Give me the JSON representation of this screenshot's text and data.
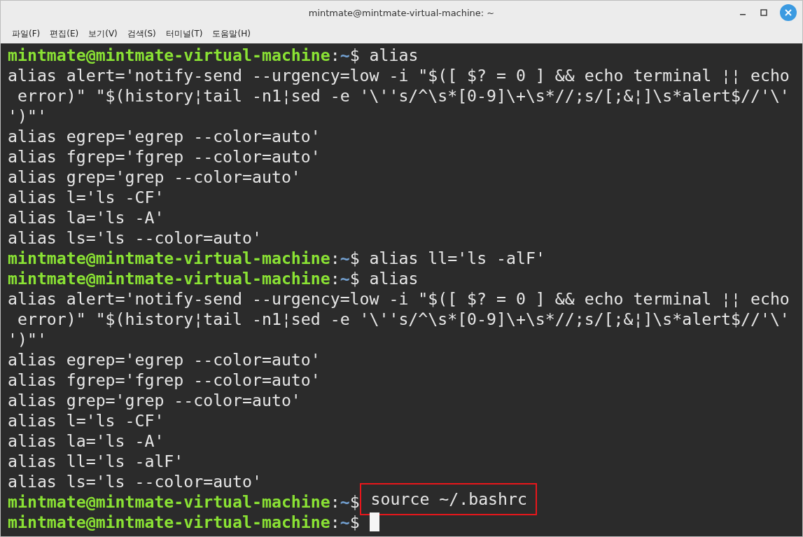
{
  "window": {
    "title": "mintmate@mintmate-virtual-machine: ~"
  },
  "menu": [
    "파일(F)",
    "편집(E)",
    "보기(V)",
    "검색(S)",
    "터미널(T)",
    "도움말(H)"
  ],
  "terminal": {
    "lines": [
      {
        "kind": "prompt",
        "user_host": "mintmate@mintmate-virtual-machine",
        "separator": ":",
        "path": "~",
        "symbol": "$",
        "command": "alias"
      },
      {
        "kind": "output",
        "text": "alias alert='notify-send --urgency=low -i \"$([ $? = 0 ] && echo terminal ¦¦ echo"
      },
      {
        "kind": "output",
        "text": " error)\" \"$(history¦tail -n1¦sed -e '\\''s/^\\s*[0-9]\\+\\s*//;s/[;&¦]\\s*alert$//'\\'"
      },
      {
        "kind": "output",
        "text": "')\"'"
      },
      {
        "kind": "output",
        "text": "alias egrep='egrep --color=auto'"
      },
      {
        "kind": "output",
        "text": "alias fgrep='fgrep --color=auto'"
      },
      {
        "kind": "output",
        "text": "alias grep='grep --color=auto'"
      },
      {
        "kind": "output",
        "text": "alias l='ls -CF'"
      },
      {
        "kind": "output",
        "text": "alias la='ls -A'"
      },
      {
        "kind": "output",
        "text": "alias ls='ls --color=auto'"
      },
      {
        "kind": "prompt",
        "user_host": "mintmate@mintmate-virtual-machine",
        "separator": ":",
        "path": "~",
        "symbol": "$",
        "command": "alias ll='ls -alF'"
      },
      {
        "kind": "prompt",
        "user_host": "mintmate@mintmate-virtual-machine",
        "separator": ":",
        "path": "~",
        "symbol": "$",
        "command": "alias"
      },
      {
        "kind": "output",
        "text": "alias alert='notify-send --urgency=low -i \"$([ $? = 0 ] && echo terminal ¦¦ echo"
      },
      {
        "kind": "output",
        "text": " error)\" \"$(history¦tail -n1¦sed -e '\\''s/^\\s*[0-9]\\+\\s*//;s/[;&¦]\\s*alert$//'\\'"
      },
      {
        "kind": "output",
        "text": "')\"'"
      },
      {
        "kind": "output",
        "text": "alias egrep='egrep --color=auto'"
      },
      {
        "kind": "output",
        "text": "alias fgrep='fgrep --color=auto'"
      },
      {
        "kind": "output",
        "text": "alias grep='grep --color=auto'"
      },
      {
        "kind": "output",
        "text": "alias l='ls -CF'"
      },
      {
        "kind": "output",
        "text": "alias la='ls -A'"
      },
      {
        "kind": "output",
        "text": "alias ll='ls -alF'"
      },
      {
        "kind": "output",
        "text": "alias ls='ls --color=auto'"
      },
      {
        "kind": "prompt",
        "user_host": "mintmate@mintmate-virtual-machine",
        "separator": ":",
        "path": "~",
        "symbol": "$",
        "command": "source ~/.bashrc",
        "highlighted": true
      },
      {
        "kind": "prompt",
        "user_host": "mintmate@mintmate-virtual-machine",
        "separator": ":",
        "path": "~",
        "symbol": "$",
        "cursor": true
      }
    ]
  }
}
